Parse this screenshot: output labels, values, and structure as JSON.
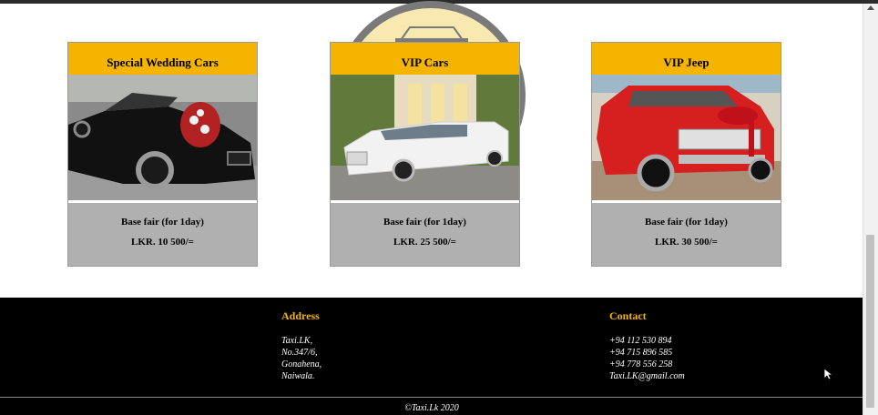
{
  "cards": [
    {
      "title": "Special Wedding Cars",
      "fare_label": "Base fair (for 1day)",
      "price": "LKR. 10 500/=",
      "image": "black convertible wedding car with flowers"
    },
    {
      "title": "VIP Cars",
      "fare_label": "Base fair (for 1day)",
      "price": "LKR. 25 500/=",
      "image": "white stretch limousine"
    },
    {
      "title": "VIP Jeep",
      "fare_label": "Base fair (for 1day)",
      "price": "LKR. 30 500/=",
      "image": "red jeep decorated with ribbon"
    }
  ],
  "footer": {
    "address_heading": "Address",
    "address_lines": [
      "Taxi.LK,",
      "No.347/6,",
      "Gonahena,",
      "Naiwala."
    ],
    "contact_heading": "Contact",
    "contact_lines": [
      "+94 112 530 894",
      "+94 715 896 585",
      "+94 778 556 258",
      "Taxi.LK@gmail.com"
    ],
    "copyright": "©Taxi.Lk 2020"
  },
  "colors": {
    "accent": "#f4b400",
    "card_body": "#b0b0b0",
    "footer_bg": "#000000"
  }
}
